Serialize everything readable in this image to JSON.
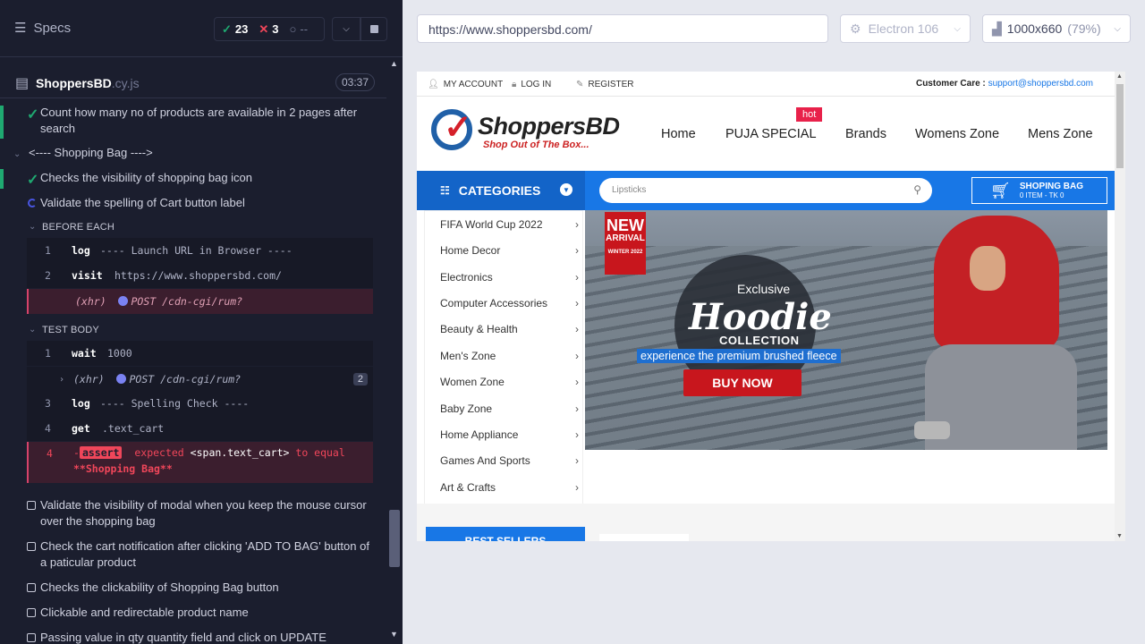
{
  "reporter": {
    "specs_label": "Specs",
    "stats": {
      "passed": "23",
      "failed": "3",
      "pending": "--"
    },
    "spec_file": {
      "name": "ShoppersBD",
      "ext": ".cy.js",
      "duration": "03:37"
    },
    "tests": {
      "count_test": "Count how many no of products are available in 2 pages after search",
      "suite_title": "<---- Shopping Bag ---->",
      "visibility_test": "Checks the visibility of shopping bag icon",
      "spelling_test": "Validate the spelling of Cart button label",
      "before_each": "BEFORE EACH",
      "test_body": "TEST BODY",
      "modal_test": "Validate the visibility of modal when you keep the mouse cursor over the shopping bag",
      "notification_test": "Check the cart notification after clicking 'ADD TO BAG' button of a paticular product",
      "clickability_test": "Checks the clickability of Shopping Bag button",
      "product_name_test": "Clickable and redirectable product name",
      "qty_test": "Passing value in qty quantity field and click on UPDATE"
    },
    "before_each_cmds": [
      {
        "num": "1",
        "name": "log",
        "msg": "---- Launch URL in Browser ----"
      },
      {
        "num": "2",
        "name": "visit",
        "msg": "https://www.shoppersbd.com/"
      }
    ],
    "xhr_label": "(xhr)",
    "xhr_msg": "POST /cdn-cgi/rum?",
    "body_cmds": [
      {
        "num": "1",
        "name": "wait",
        "msg": "1000"
      },
      {
        "num": "3",
        "name": "log",
        "msg": "---- Spelling Check ----"
      },
      {
        "num": "4",
        "name": "get",
        "msg": ".text_cart"
      }
    ],
    "xhr_count": "2",
    "assert": {
      "num": "4",
      "badge": "assert",
      "line1_a": "expected",
      "line1_b": "<span.text_cart>",
      "line1_c": "to equal",
      "line2": "**Shopping Bag**"
    }
  },
  "browser_bar": {
    "url": "https://www.shoppersbd.com/",
    "browser": "Electron 106",
    "viewport": "1000x660",
    "zoom": "(79%)"
  },
  "site": {
    "topbar": {
      "my_account": "MY ACCOUNT",
      "login": "LOG IN",
      "register": "REGISTER",
      "care_label": "Customer Care :",
      "care_email": "support@shoppersbd.com"
    },
    "logo": {
      "brand": "ShoppersBD",
      "tagline": "Shop Out of The Box..."
    },
    "nav": [
      "Home",
      "PUJA SPECIAL",
      "Brands",
      "Womens Zone",
      "Mens Zone"
    ],
    "hot_badge": "hot",
    "categories_label": "CATEGORIES",
    "search_placeholder": "Lipsticks",
    "bag": {
      "title": "SHOPING BAG",
      "sub": "0 ITEM - TK 0"
    },
    "categories": [
      "FIFA World Cup 2022",
      "Home Decor",
      "Electronics",
      "Computer Accessories",
      "Beauty & Health",
      "Men's Zone",
      "Women Zone",
      "Baby Zone",
      "Home Appliance",
      "Games And Sports",
      "Art & Crafts"
    ],
    "banner": {
      "new": "NEW",
      "arrival": "ARRIVAL",
      "winter": "WINTER 2022",
      "exclusive": "Exclusive",
      "hoodie": "Hoodie",
      "collection": "COLLECTION",
      "tagline": "experience the premium brushed fleece",
      "buy_now": "BUY NOW"
    },
    "best_sellers": "BEST SELLERS"
  },
  "colors": {
    "pass": "#1fa971",
    "fail": "#f0465a",
    "site_blue": "#1877e6",
    "site_red": "#c8161d"
  }
}
